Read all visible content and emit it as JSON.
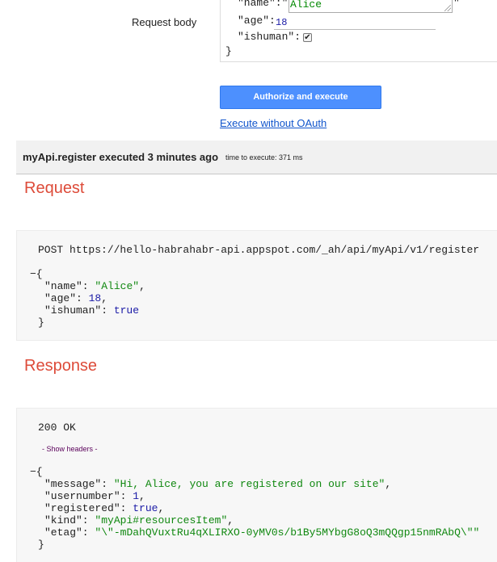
{
  "form": {
    "label": "Request body",
    "name_key": "\"name\":\"",
    "name_value": "Alice",
    "name_trailing": "\"",
    "age_key": "\"age\":",
    "age_value": "18",
    "ishuman_key": "\"ishuman\":",
    "ishuman_checked": true,
    "close_brace": "}"
  },
  "actions": {
    "authorize_label": "Authorize and execute",
    "execute_without_oauth_label": "Execute without OAuth"
  },
  "execution": {
    "title": "myApi.register executed 3 minutes ago",
    "time_to_execute": "time to execute: 371 ms"
  },
  "request": {
    "section_title": "Request",
    "method_url": "POST https://hello-habrahabr-api.appspot.com/_ah/api/myApi/v1/register",
    "collapse_toggle": "−{",
    "body": {
      "name": "Alice",
      "age": "18",
      "ishuman": "true"
    },
    "close_brace": "}"
  },
  "response": {
    "section_title": "Response",
    "status": "200 OK",
    "show_headers": "- Show headers -",
    "collapse_toggle": "−{",
    "body": {
      "message": "Hi, Alice, you are registered on our site",
      "usernumber": "1",
      "registered": "true",
      "kind": "myApi#resourcesItem",
      "etag": "\\\"-mDahQVuxtRu4qXLIRXO-0yMV0s/b1By5MYbgG8oQ3mQQgp15nmRAbQ\\\""
    },
    "close_brace": "}"
  },
  "colors": {
    "section_title": "#dd4b39",
    "string_value": "#108810",
    "number_value": "#1a1aa6",
    "button_blue": "#4d90fe",
    "link": "#1155cc"
  }
}
